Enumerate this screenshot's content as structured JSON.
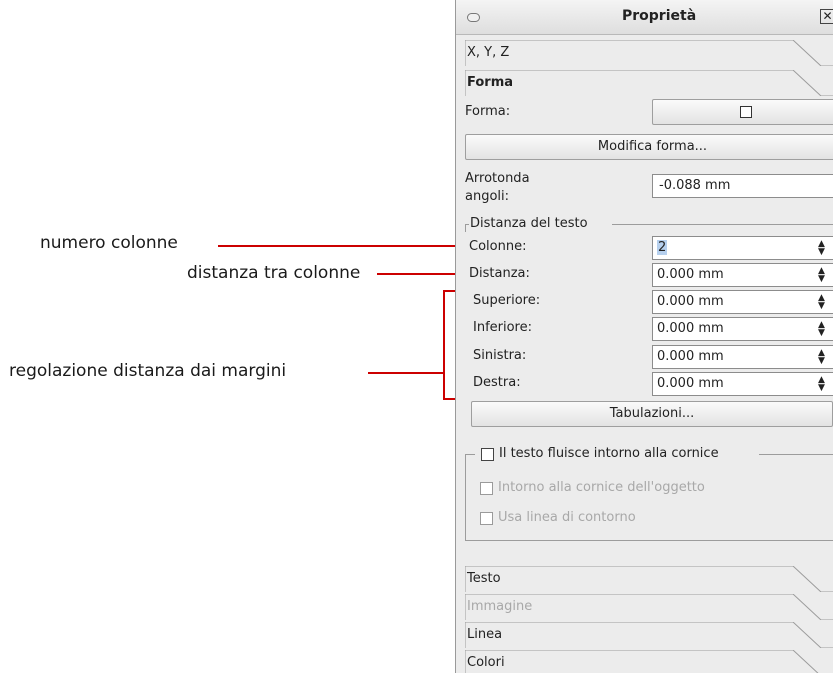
{
  "annotations": {
    "numero_colonne": "numero colonne",
    "distanza_tra_colonne": "distanza tra colonne",
    "regolazione": "regolazione distanza dai margini"
  },
  "window": {
    "title": "Proprietà"
  },
  "tabs": {
    "xyz": "X, Y, Z",
    "forma": "Forma"
  },
  "forma": {
    "shape_label": "Forma:",
    "modifica_button": "Modifica forma...",
    "arrotonda_label_1": "Arrotonda",
    "arrotonda_label_2": "angoli:",
    "arrotonda_value": "-0.088 mm"
  },
  "distanza_testo": {
    "group_title": "Distanza del testo",
    "colonne_label": "Colonne:",
    "colonne_value": "2",
    "distanza_label": "Distanza:",
    "distanza_value": "0.000 mm",
    "superiore_label": "Superiore:",
    "superiore_value": "0.000 mm",
    "inferiore_label": "Inferiore:",
    "inferiore_value": "0.000 mm",
    "sinistra_label": "Sinistra:",
    "sinistra_value": "0.000 mm",
    "destra_label": "Destra:",
    "destra_value": "0.000 mm",
    "tabulazioni_button": "Tabulazioni..."
  },
  "flow": {
    "main": "Il testo fluisce intorno alla cornice",
    "cornice_oggetto": "Intorno alla cornice dell'oggetto",
    "linea_contorno": "Usa linea di contorno"
  },
  "bottom_tabs": {
    "testo": "Testo",
    "immagine": "Immagine",
    "linea": "Linea",
    "colori": "Colori"
  },
  "colors": {
    "annotation_line": "#cc0000",
    "selection": "#b6d0ee",
    "panel_bg": "#ececec"
  }
}
